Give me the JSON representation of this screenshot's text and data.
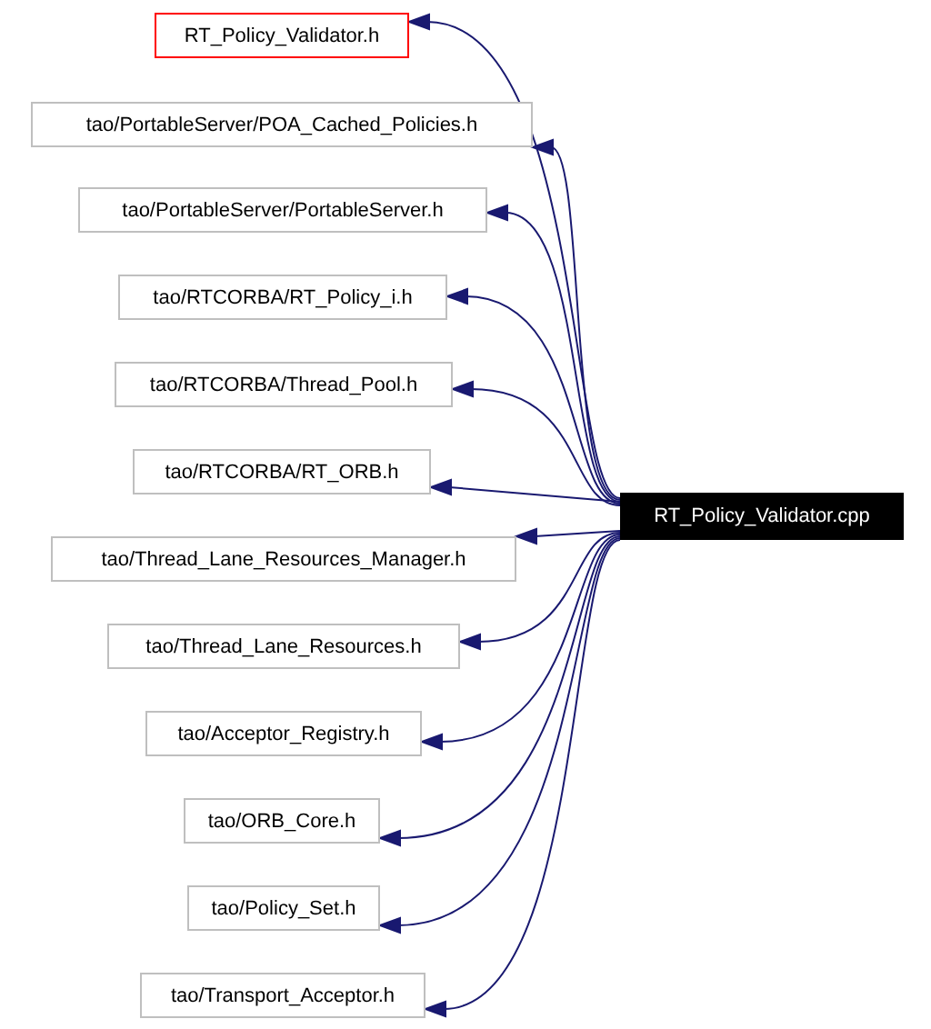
{
  "graph": {
    "source": {
      "label": "RT_Policy_Validator.cpp"
    },
    "includes": [
      {
        "label": "RT_Policy_Validator.h",
        "highlighted": true
      },
      {
        "label": "tao/PortableServer/POA_Cached_Policies.h",
        "highlighted": false
      },
      {
        "label": "tao/PortableServer/PortableServer.h",
        "highlighted": false
      },
      {
        "label": "tao/RTCORBA/RT_Policy_i.h",
        "highlighted": false
      },
      {
        "label": "tao/RTCORBA/Thread_Pool.h",
        "highlighted": false
      },
      {
        "label": "tao/RTCORBA/RT_ORB.h",
        "highlighted": false
      },
      {
        "label": "tao/Thread_Lane_Resources_Manager.h",
        "highlighted": false
      },
      {
        "label": "tao/Thread_Lane_Resources.h",
        "highlighted": false
      },
      {
        "label": "tao/Acceptor_Registry.h",
        "highlighted": false
      },
      {
        "label": "tao/ORB_Core.h",
        "highlighted": false
      },
      {
        "label": "tao/Policy_Set.h",
        "highlighted": false
      },
      {
        "label": "tao/Transport_Acceptor.h",
        "highlighted": false
      }
    ]
  }
}
